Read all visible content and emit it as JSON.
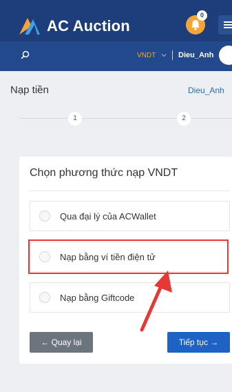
{
  "header": {
    "brand": "AC Auction",
    "notification_count": "0",
    "currency": "VNDT",
    "username": "Dieu_Anh"
  },
  "page": {
    "title": "Nạp tiền",
    "user": "Dieu_Anh",
    "steps": [
      "1",
      "2"
    ]
  },
  "deposit_card": {
    "title": "Chọn phương thức nạp VNDT",
    "options": [
      {
        "label": "Qua đại lý của ACWallet"
      },
      {
        "label": "Nạp bằng ví tiền điện tử"
      },
      {
        "label": "Nạp bằng Giftcode"
      }
    ],
    "back_label": "← Quay lại",
    "next_label": "Tiếp tục →"
  },
  "colors": {
    "header_bg": "#1d3e7a",
    "accent": "#f4a537",
    "primary_button": "#1e63c4",
    "secondary_button": "#6c757d",
    "highlight": "#e53935"
  },
  "icons": [
    "logo-icon",
    "bell-icon",
    "menu-icon",
    "search-icon",
    "chevron-down-icon",
    "avatar"
  ]
}
